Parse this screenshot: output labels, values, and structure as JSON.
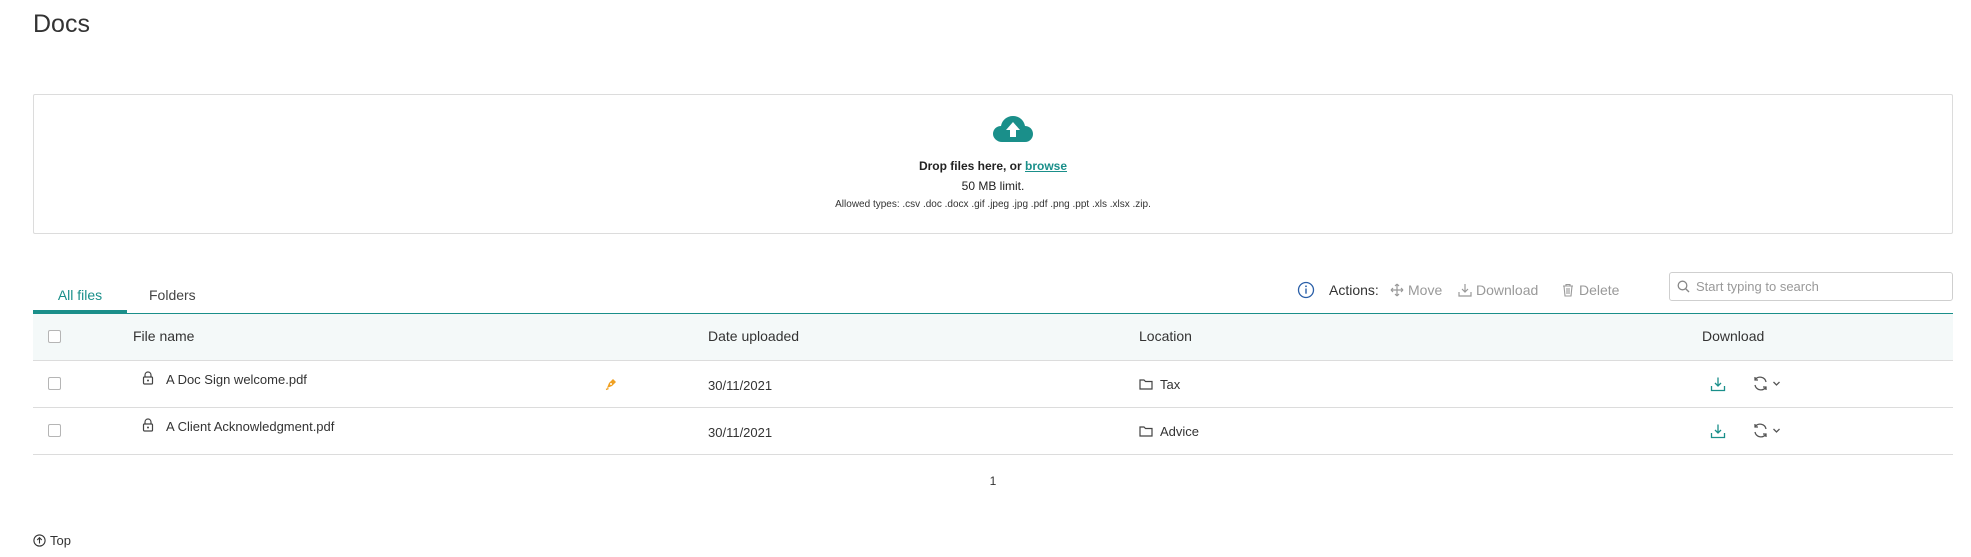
{
  "page": {
    "title": "Docs"
  },
  "upload": {
    "icon": "cloud-upload-icon",
    "prompt": "Drop files here, or ",
    "browse_label": "browse",
    "limit": "50 MB limit.",
    "allowed_types": "Allowed types: .csv .doc .docx .gif .jpeg .jpg .pdf .png .ppt .xls .xlsx .zip."
  },
  "tabs": [
    {
      "label": "All files",
      "active": true
    },
    {
      "label": "Folders",
      "active": false
    }
  ],
  "actions": {
    "label": "Actions:",
    "move": "Move",
    "download": "Download",
    "delete": "Delete"
  },
  "search": {
    "placeholder": "Start typing to search",
    "value": ""
  },
  "table": {
    "headers": {
      "name": "File name",
      "date": "Date uploaded",
      "location": "Location",
      "download": "Download"
    },
    "rows": [
      {
        "name": "A Doc Sign welcome.pdf",
        "date": "30/11/2021",
        "location": "Tax",
        "sign_pending": true
      },
      {
        "name": "A Client Acknowledgment.pdf",
        "date": "30/11/2021",
        "location": "Advice",
        "sign_pending": false
      }
    ]
  },
  "pagination": {
    "current": "1"
  },
  "footer": {
    "top_label": "Top"
  },
  "colors": {
    "accent": "#1a8f8a",
    "sign": "#f0a020",
    "header_bg": "#f4f9f9"
  }
}
